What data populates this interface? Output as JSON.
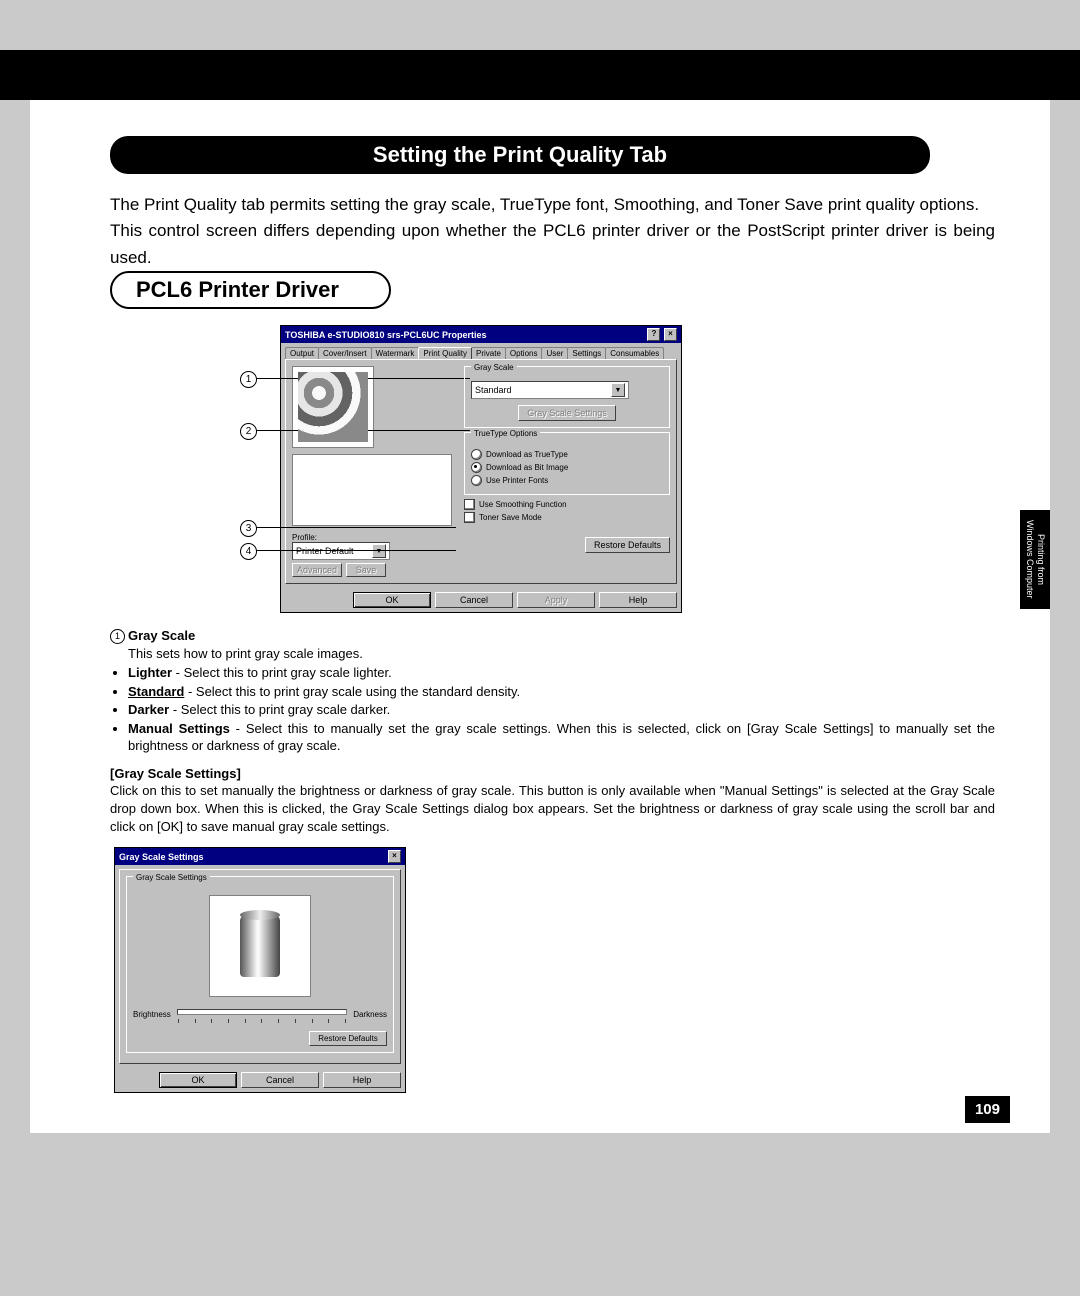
{
  "blackbar": "",
  "heading": "Setting the Print Quality Tab",
  "intro_p1": "The Print Quality tab permits setting the gray scale, TrueType font, Smoothing, and Toner Save print quality options.",
  "intro_p2": "This control screen differs depending upon whether the PCL6 printer driver or the PostScript printer driver is being used.",
  "subheading": "PCL6 Printer Driver",
  "sidetab_l1": "Printing from",
  "sidetab_l2": "Windows Computer",
  "page_number": "109",
  "dialog1": {
    "title": "TOSHIBA e-STUDIO810 srs-PCL6UC Properties",
    "tabs": [
      "Output",
      "Cover/Insert",
      "Watermark",
      "Print Quality",
      "Private",
      "Options",
      "User",
      "Settings",
      "Consumables"
    ],
    "active_tab": "Print Quality",
    "groups": {
      "grayscale": {
        "title": "Gray Scale",
        "value": "Standard",
        "btn": "Gray Scale Settings"
      },
      "truetype": {
        "title": "TrueType Options",
        "opt1": "Download as TrueType",
        "opt2": "Download as Bit Image",
        "opt3": "Use Printer Fonts"
      },
      "smoothing": "Use Smoothing Function",
      "toner": "Toner Save Mode",
      "profile_label": "Profile:",
      "profile_value": "Printer Default",
      "btn_adv": "Advanced",
      "btn_save": "Save",
      "btn_restore": "Restore Defaults"
    },
    "footer": {
      "ok": "OK",
      "cancel": "Cancel",
      "apply": "Apply",
      "help": "Help"
    }
  },
  "callouts": {
    "c1": "1",
    "c2": "2",
    "c3": "3",
    "c4": "4"
  },
  "desc": {
    "h1": "Gray Scale",
    "p1": "This sets how to print gray scale images.",
    "li1a": "Lighter",
    "li1b": " - Select this to print gray scale lighter.",
    "li2a": "Standard",
    "li2b": " - Select this to print gray scale using the standard density.",
    "li3a": "Darker",
    "li3b": " - Select this to print gray scale darker.",
    "li4a": "Manual Settings",
    "li4b": " - Select this to manually set the gray scale settings.  When this is selected, click on [Gray Scale Settings] to manually set the brightness or darkness of gray scale.",
    "h2": "[Gray Scale Settings]",
    "p2": "Click on this to set manually the brightness or darkness of gray scale.  This button is only available when \"Manual Settings\" is selected at the Gray Scale drop down box.  When this is clicked, the Gray Scale Settings dialog box appears.  Set the brightness or darkness of gray scale using the scroll bar and click on [OK] to save manual gray scale settings."
  },
  "dialog2": {
    "title": "Gray Scale Settings",
    "group": "Gray Scale Settings",
    "left": "Brightness",
    "right": "Darkness",
    "btn_restore": "Restore Defaults",
    "ok": "OK",
    "cancel": "Cancel",
    "help": "Help"
  }
}
